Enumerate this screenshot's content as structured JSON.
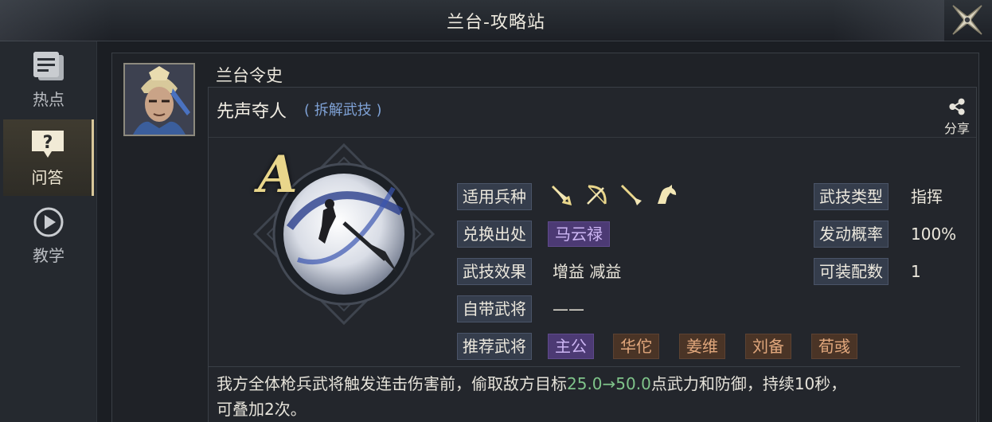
{
  "window": {
    "title": "兰台-攻略站"
  },
  "sidebar": {
    "items": [
      {
        "label": "热点",
        "icon": "document-icon"
      },
      {
        "label": "问答",
        "icon": "question-icon",
        "active": true
      },
      {
        "label": "教学",
        "icon": "play-icon"
      }
    ]
  },
  "general": {
    "title": "兰台令史"
  },
  "skill": {
    "name": "先声夺人",
    "tag": "( 拆解武技 )",
    "grade": "A",
    "share_label": "分享",
    "labels": {
      "troops": "适用兵种",
      "source": "兑换出处",
      "effect": "武技效果",
      "builtin": "自带武将",
      "recommend": "推荐武将",
      "type": "武技类型",
      "chance": "发动概率",
      "slots": "可装配数"
    },
    "troop_icons": [
      "sword-icon",
      "bow-icon",
      "spear-icon",
      "horse-icon"
    ],
    "source_value": "马云禄",
    "effect_value": "增益 减益",
    "builtin_value": "——",
    "recommend": [
      {
        "name": "主公",
        "style": "purple"
      },
      {
        "name": "华佗",
        "style": "brown"
      },
      {
        "name": "姜维",
        "style": "brown"
      },
      {
        "name": "刘备",
        "style": "brown"
      },
      {
        "name": "荀彧",
        "style": "brown"
      }
    ],
    "type_value": "指挥",
    "chance_value": "100%",
    "slots_value": "1",
    "desc": {
      "part1": "我方全体枪兵武将触发连击伤害前，偷取敌方目标",
      "num": "25.0→50.0",
      "part2": "点武力和防御，持续10秒，",
      "line2": "可叠加2次。"
    }
  },
  "colors": {
    "accent": "#e9d68b",
    "label_bg": "#353d4c",
    "purple_chip": "#4c3a74",
    "brown_chip": "#4a3426",
    "number_green": "#7fc48a"
  }
}
